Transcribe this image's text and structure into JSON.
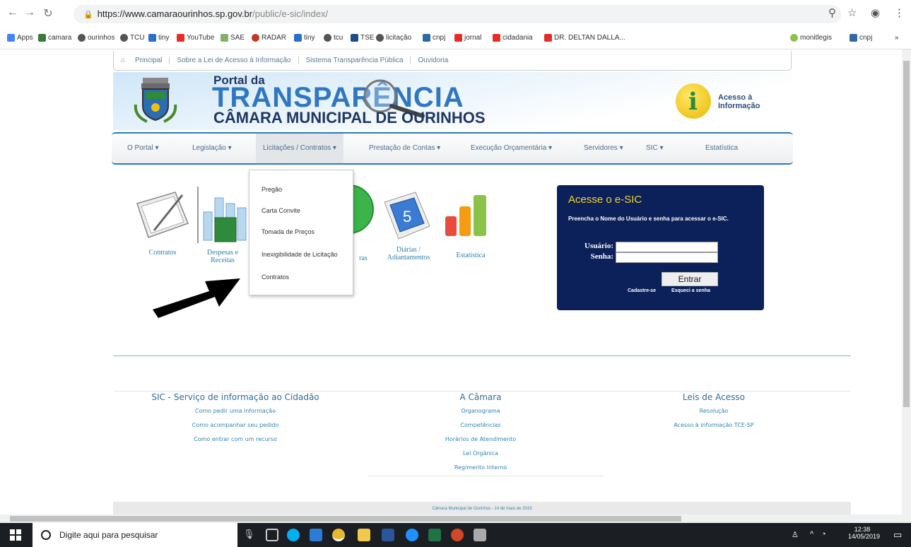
{
  "browser": {
    "url_host": "https://www.camaraourinhos.sp.gov.br",
    "url_path": "/public/e-sic/index/",
    "bookmarks": [
      "Apps",
      "camara",
      "ourinhos",
      "TCU",
      "tiny",
      "YouTube",
      "SAE",
      "RADAR",
      "tiny",
      "tcu",
      "TSE",
      "licitação",
      "cnpj",
      "jornal",
      "cidadania",
      "DR. DELTAN DALLA...",
      "monitlegis",
      "cnpj"
    ]
  },
  "topnav": {
    "items": [
      "Principal",
      "Sobre a Lei de Acesso à Informação",
      "Sistema Transparência Pública",
      "Ouvidoria"
    ]
  },
  "banner": {
    "portal_da": "Portal da",
    "title": "TRANSPARÊNCIA",
    "subtitle": "CÂMARA MUNICIPAL DE OURINHOS",
    "acesso_line1": "Acesso à",
    "acesso_line2": "Informação"
  },
  "menu": {
    "items": [
      "O Portal ▾",
      "Legislação ▾",
      "Licitações / Contratos ▾",
      "Prestação de Contas ▾",
      "Execução Orçamentária ▾",
      "Servidores ▾",
      "SIC ▾",
      "Estatística"
    ]
  },
  "dropdown": {
    "items": [
      "Pregão",
      "Carta Convite",
      "Tomada de Preços",
      "Inexigibilidade de Licitação",
      "Contratos"
    ]
  },
  "tiles": {
    "contratos": "Contratos",
    "despesas_1": "Despesas e",
    "despesas_2": "Receitas",
    "compras_partial": "ras",
    "diarias_1": "Diárias /",
    "diarias_2": "Adiantamentos",
    "estatistica": "Estatística",
    "calendar_number": "5"
  },
  "esic": {
    "title": "Acesse o e-SIC",
    "description": "Preencha o Nome do Usuário e senha para acessar o e-SIC.",
    "user_label": "Usuário:",
    "pass_label": "Senha:",
    "submit": "Entrar",
    "register": "Cadastre-se",
    "forgot": "Esqueci a senha"
  },
  "footer": {
    "sic": {
      "heading": "SIC - Serviço de informação ao Cidadão",
      "links": [
        "Como pedir uma informação",
        "Como acompanhar seu pedido",
        "Como entrar com um recurso"
      ]
    },
    "camara": {
      "heading": "A Câmara",
      "links": [
        "Organograma",
        "Competências",
        "Horários de Atendimento",
        "Lei Orgânica",
        "Regimento Interno"
      ]
    },
    "leis": {
      "heading": "Leis de Acesso",
      "links": [
        "Resolução",
        "Acesso à informação TCE-SP"
      ]
    },
    "copyright": "Câmara Municipal de Ourinhos - 14 de maio de 2019"
  },
  "taskbar": {
    "search_placeholder": "Digite aqui para pesquisar",
    "time": "12:38",
    "date": "14/05/2019"
  },
  "colors": {
    "esic_bg": "#0c2159",
    "esic_title": "#f5d428",
    "link": "#2f85b5",
    "menu_border": "#2c7bbf"
  }
}
